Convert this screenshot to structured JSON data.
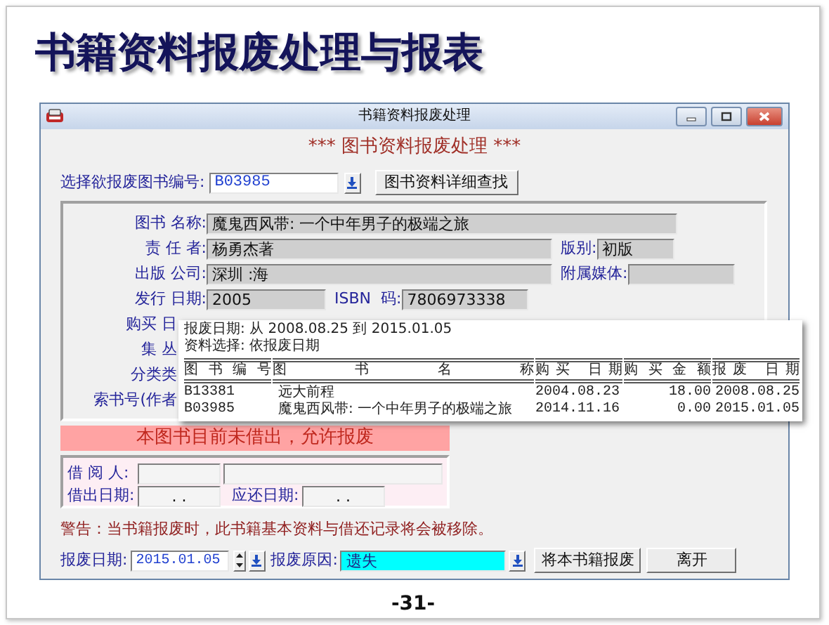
{
  "slide": {
    "title": "书籍资料报废处理与报表",
    "page_number": "-31-"
  },
  "window": {
    "title": "书籍资料报废处理"
  },
  "heading": "*** 图书资料报废处理 ***",
  "book_select": {
    "label": "选择欲报废图书编号:",
    "value": "B03985"
  },
  "search_button": "图书资料详细查找",
  "details": [
    [
      {
        "kind": "field",
        "label": "图书 名称:",
        "value": "魔鬼西风带: 一个中年男子的极端之旅"
      }
    ],
    [
      {
        "kind": "field",
        "label": "责 任 者:",
        "value": "杨勇杰著"
      },
      {
        "kind": "field",
        "label": "版别:",
        "value": "初版"
      }
    ],
    [
      {
        "kind": "field",
        "label": "出版 公司:",
        "value": "深圳 :海"
      },
      {
        "kind": "field",
        "label": "附属媒体:"
      }
    ],
    [
      {
        "kind": "field",
        "label": "发行 日期:",
        "value": "2005"
      },
      {
        "kind": "field",
        "label": "ISBN  码:",
        "value": "7806973338"
      }
    ],
    [
      {
        "kind": "label",
        "label": "购买 日"
      }
    ],
    [
      {
        "kind": "label",
        "label": "集 丛"
      }
    ],
    [
      {
        "kind": "label",
        "label": "分类类"
      }
    ],
    [
      {
        "kind": "label",
        "label": "索书号(作者"
      }
    ]
  ],
  "status_banner": "本图书目前未借出，允许报废",
  "borrow": {
    "borrower_label": "借 阅 人:",
    "loan_date_label": "借出日期:",
    "loan_date_value": ". .",
    "due_date_label": "应还日期:",
    "due_date_value": ". ."
  },
  "warning": "警告：当书籍报废时，此书籍基本资料与借还记录将会被移除。",
  "scrap_date": {
    "label": "报废日期:",
    "value": "2015.01.05"
  },
  "scrap_reason": {
    "label": "报废原因:",
    "value": "遗失"
  },
  "buttons": [
    "将本书籍报废",
    "离开"
  ],
  "report": {
    "lines": [
      "报废日期: 从 2008.08.25 到 2015.01.05",
      "资料选择: 依报废日期"
    ],
    "columns": [
      "图 书 编 号",
      "图 书 名 称",
      "购买 日期",
      "购 买 金 额",
      "报废 日期"
    ],
    "rows": [
      [
        "B13381",
        "远大前程",
        "2004.08.23",
        "18.00",
        "2008.08.25"
      ],
      [
        "B03985",
        "魔鬼西风带: 一个中年男子的极端之旅",
        "2014.11.16",
        "0.00",
        "2015.01.05"
      ]
    ]
  }
}
